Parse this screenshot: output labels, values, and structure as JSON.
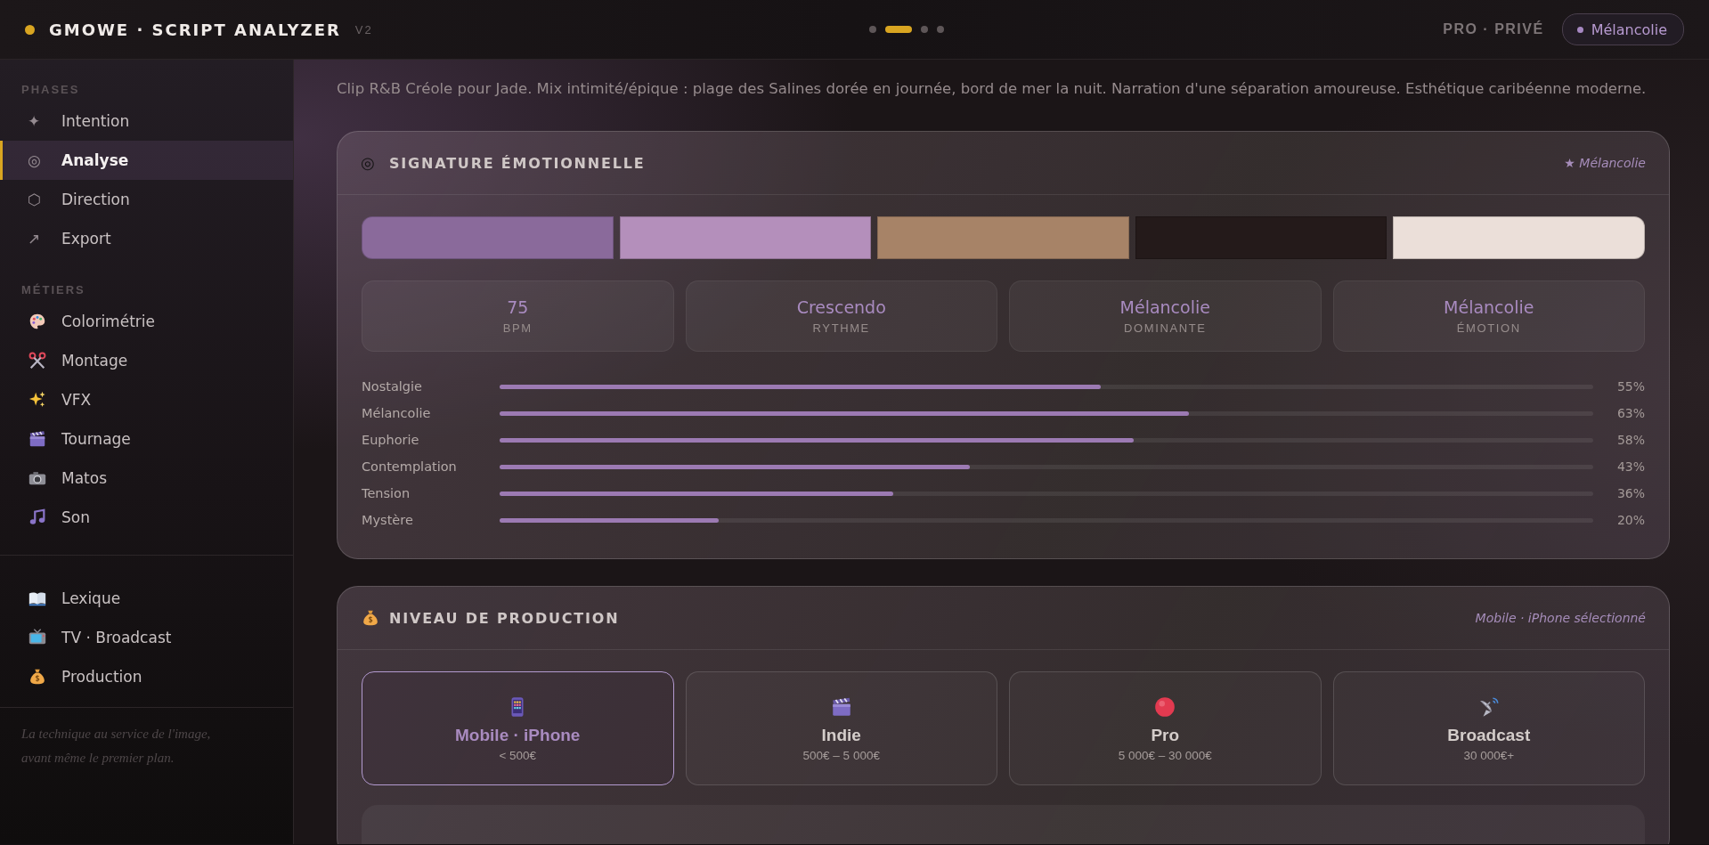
{
  "header": {
    "title": "GMOWE · SCRIPT ANALYZER",
    "version": "V2",
    "steps": [
      {
        "selected": false
      },
      {
        "selected": true
      },
      {
        "selected": false
      },
      {
        "selected": false
      }
    ],
    "plan": "PRO · PRIVÉ",
    "mood_pill": "Mélancolie"
  },
  "sidebar": {
    "sections": [
      {
        "label": "PHASES",
        "items": [
          {
            "icon": "✦",
            "label": "Intention",
            "selected": false
          },
          {
            "icon": "◎",
            "label": "Analyse",
            "selected": true
          },
          {
            "icon": "⬡",
            "label": "Direction",
            "selected": false
          },
          {
            "icon": "↗",
            "label": "Export",
            "selected": false
          }
        ]
      },
      {
        "label": "MÉTIERS",
        "items": [
          {
            "kind": "palette",
            "label": "Colorimétrie",
            "selected": false
          },
          {
            "kind": "scissors",
            "label": "Montage",
            "selected": false
          },
          {
            "kind": "sparkles",
            "label": "VFX",
            "selected": false
          },
          {
            "kind": "clapper",
            "label": "Tournage",
            "selected": false
          },
          {
            "kind": "camera",
            "label": "Matos",
            "selected": false
          },
          {
            "kind": "music",
            "label": "Son",
            "selected": false
          }
        ]
      },
      {
        "items": [
          {
            "kind": "book",
            "label": "Lexique",
            "selected": false
          },
          {
            "kind": "tv",
            "label": "TV · Broadcast",
            "selected": false
          },
          {
            "kind": "moneybag",
            "label": "Production",
            "selected": false
          }
        ]
      }
    ],
    "footer": "La technique au service de l'image, avant même le premier plan."
  },
  "intro": "Clip R&B Créole pour Jade. Mix intimité/épique : plage des Salines dorée en journée, bord de mer la nuit. Narration d'une séparation amoureuse. Esthétique caribéenne moderne.",
  "emotion_card": {
    "icon": "◎",
    "title": "SIGNATURE ÉMOTIONNELLE",
    "note": "★ Mélancolie",
    "palette": [
      {
        "color": "#8a6a9b"
      },
      {
        "color": "#b48fbb"
      },
      {
        "color": "#a78367"
      },
      {
        "color": "#241a1a"
      },
      {
        "color": "#ebdfd9"
      }
    ],
    "stats": [
      {
        "value": "75",
        "label": "BPM"
      },
      {
        "value": "Crescendo",
        "label": "RYTHME"
      },
      {
        "value": "Mélancolie",
        "label": "DOMINANTE"
      },
      {
        "value": "Mélancolie",
        "label": "ÉMOTION"
      }
    ],
    "emotions": [
      {
        "name": "Nostalgie",
        "level": 0.55,
        "reading": "55%"
      },
      {
        "name": "Mélancolie",
        "level": 0.63,
        "reading": "63%"
      },
      {
        "name": "Euphorie",
        "level": 0.58,
        "reading": "58%"
      },
      {
        "name": "Contemplation",
        "level": 0.43,
        "reading": "43%"
      },
      {
        "name": "Tension",
        "level": 0.36,
        "reading": "36%"
      },
      {
        "name": "Mystère",
        "level": 0.2,
        "reading": "20%"
      }
    ]
  },
  "production_card": {
    "title": "NIVEAU DE PRODUCTION",
    "note": "Mobile · iPhone sélectionné",
    "tiers": [
      {
        "kind": "phone",
        "name": "Mobile · iPhone",
        "price": "< 500€",
        "selected": true
      },
      {
        "kind": "clapper",
        "name": "Indie",
        "price": "500€ – 5 000€",
        "selected": false
      },
      {
        "kind": "record",
        "name": "Pro",
        "price": "5 000€ – 30 000€",
        "selected": false
      },
      {
        "kind": "satellite",
        "name": "Broadcast",
        "price": "30 000€+",
        "selected": false
      }
    ]
  }
}
